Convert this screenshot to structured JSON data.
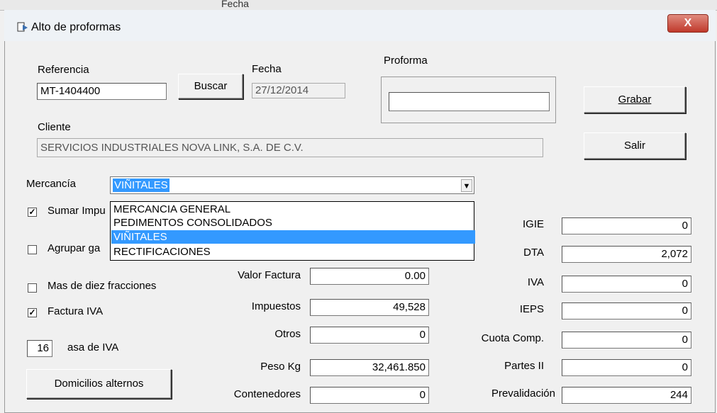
{
  "background": {
    "partial_text": "Fecha"
  },
  "window": {
    "title": "Alto de proformas",
    "close_label": "X"
  },
  "form": {
    "referencia": {
      "label": "Referencia",
      "value": "MT-1404400"
    },
    "buscar_button": "Buscar",
    "fecha": {
      "label": "Fecha",
      "value": "27/12/2014"
    },
    "proforma": {
      "label": "Proforma",
      "value": ""
    },
    "grabar_button": "Grabar",
    "salir_button": "Salir",
    "cliente": {
      "label": "Cliente",
      "value": "SERVICIOS INDUSTRIALES NOVA LINK, S.A. DE C.V."
    },
    "mercancia": {
      "label": "Mercancía",
      "selected": "VIÑITALES",
      "options": [
        "MERCANCIA GENERAL",
        "PEDIMENTOS CONSOLIDADOS",
        "VIÑITALES",
        "RECTIFICACIONES"
      ]
    },
    "checkboxes": [
      {
        "label": "Sumar Impu",
        "checked": true
      },
      {
        "label": "Agrupar ga",
        "checked": false
      },
      {
        "label": "Mas de diez fracciones",
        "checked": false
      },
      {
        "label": "Factura IVA",
        "checked": true
      }
    ],
    "tasa_iva": {
      "value": "16",
      "label": "asa de IVA"
    },
    "domicilios_button": "Domicilios alternos",
    "mid_fields": [
      {
        "label": "Valor Factura",
        "value": "0.00"
      },
      {
        "label": "Impuestos",
        "value": "49,528"
      },
      {
        "label": "Otros",
        "value": "0"
      },
      {
        "label": "Peso Kg",
        "value": "32,461.850"
      },
      {
        "label": "Contenedores",
        "value": "0"
      }
    ],
    "right_fields": [
      {
        "label": "IGIE",
        "value": "0"
      },
      {
        "label": "DTA",
        "value": "2,072"
      },
      {
        "label": "IVA",
        "value": "0"
      },
      {
        "label": "IEPS",
        "value": "0"
      },
      {
        "label": "Cuota Comp.",
        "value": "0"
      },
      {
        "label": "Partes II",
        "value": "0"
      },
      {
        "label": "Prevalidación",
        "value": "244"
      }
    ]
  },
  "colors": {
    "selection": "#3399ff",
    "close": "#c0392b"
  }
}
